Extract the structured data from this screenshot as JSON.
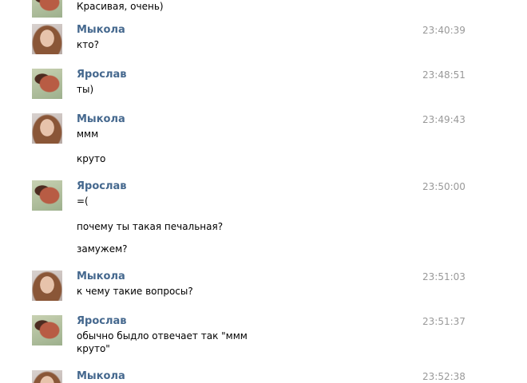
{
  "messages": [
    {
      "author": "",
      "time": "",
      "avatar": "male-avatar-icon",
      "lines": [
        "Красивая, очень)"
      ]
    },
    {
      "author": "Мыкола",
      "time": "23:40:39",
      "avatar": "female-avatar-icon",
      "lines": [
        "кто?"
      ]
    },
    {
      "author": "Ярослав",
      "time": "23:48:51",
      "avatar": "male-avatar-icon",
      "lines": [
        "ты)"
      ]
    },
    {
      "author": "Мыкола",
      "time": "23:49:43",
      "avatar": "female-avatar-icon",
      "lines": [
        "ммм",
        "круто"
      ]
    },
    {
      "author": "Ярослав",
      "time": "23:50:00",
      "avatar": "male-avatar-icon",
      "lines": [
        "=(",
        "почему ты такая печальная?",
        "замужем?"
      ]
    },
    {
      "author": "Мыкола",
      "time": "23:51:03",
      "avatar": "female-avatar-icon",
      "lines": [
        "к чему такие вопросы?"
      ]
    },
    {
      "author": "Ярослав",
      "time": "23:51:37",
      "avatar": "male-avatar-icon",
      "lines": [
        "обычно быдло отвечает так \"ммм",
        "круто\""
      ]
    },
    {
      "author": "Мыкола",
      "time": "23:52:38",
      "avatar": "female-avatar-icon",
      "lines": []
    }
  ]
}
